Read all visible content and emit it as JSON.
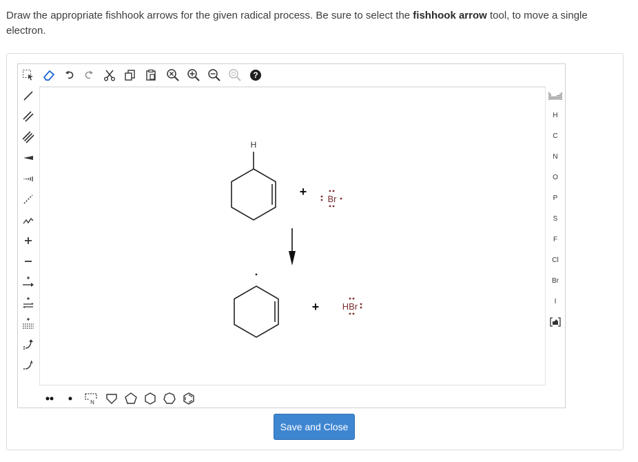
{
  "prompt": {
    "part1": "Draw the appropriate fishhook arrows for the given radical process. Be sure to select the ",
    "bold": "fishhook arrow",
    "part2": " tool, to move a single electron."
  },
  "top_toolbar": [
    {
      "name": "select-lasso-icon"
    },
    {
      "name": "eraser-icon"
    },
    {
      "name": "undo-icon"
    },
    {
      "name": "redo-icon"
    },
    {
      "name": "cut-icon"
    },
    {
      "name": "copy-icon"
    },
    {
      "name": "paste-icon"
    },
    {
      "name": "zoom-reset-icon"
    },
    {
      "name": "zoom-in-icon"
    },
    {
      "name": "zoom-out-icon"
    },
    {
      "name": "template-search-icon"
    },
    {
      "name": "help-icon"
    }
  ],
  "left_toolbar": [
    {
      "name": "single-bond-icon"
    },
    {
      "name": "double-bond-icon"
    },
    {
      "name": "triple-bond-icon"
    },
    {
      "name": "wedge-bond-icon"
    },
    {
      "name": "hash-bond-icon"
    },
    {
      "name": "dashed-bond-icon"
    },
    {
      "name": "chain-icon"
    },
    {
      "name": "plus-charge-icon"
    },
    {
      "name": "minus-charge-icon"
    },
    {
      "name": "reaction-arrow-icon"
    },
    {
      "name": "equilibrium-arrow-icon"
    },
    {
      "name": "resonance-arrow-icon"
    },
    {
      "name": "curved-arrow-icon"
    },
    {
      "name": "fishhook-arrow-icon"
    }
  ],
  "right_toolbar": {
    "elements": [
      "H",
      "C",
      "N",
      "O",
      "P",
      "S",
      "F",
      "Cl",
      "Br",
      "I"
    ]
  },
  "canvas": {
    "reactant_h": "H",
    "plus1": "+",
    "br_label": "Br",
    "plus2": "+",
    "hbr_label": "HBr"
  },
  "bottom_toolbar": [
    {
      "name": "lone-pair-icon"
    },
    {
      "name": "radical-icon"
    },
    {
      "name": "ring-3-icon"
    },
    {
      "name": "ring-4-icon"
    },
    {
      "name": "ring-5-icon"
    },
    {
      "name": "ring-6-icon"
    },
    {
      "name": "ring-7-icon"
    },
    {
      "name": "benzene-icon"
    }
  ],
  "save_button": {
    "label": "Save and Close"
  },
  "colors": {
    "accent": "#3f86d1",
    "selected_tool": "#2a6fd6",
    "lone_pair": "#7a2e2e"
  }
}
